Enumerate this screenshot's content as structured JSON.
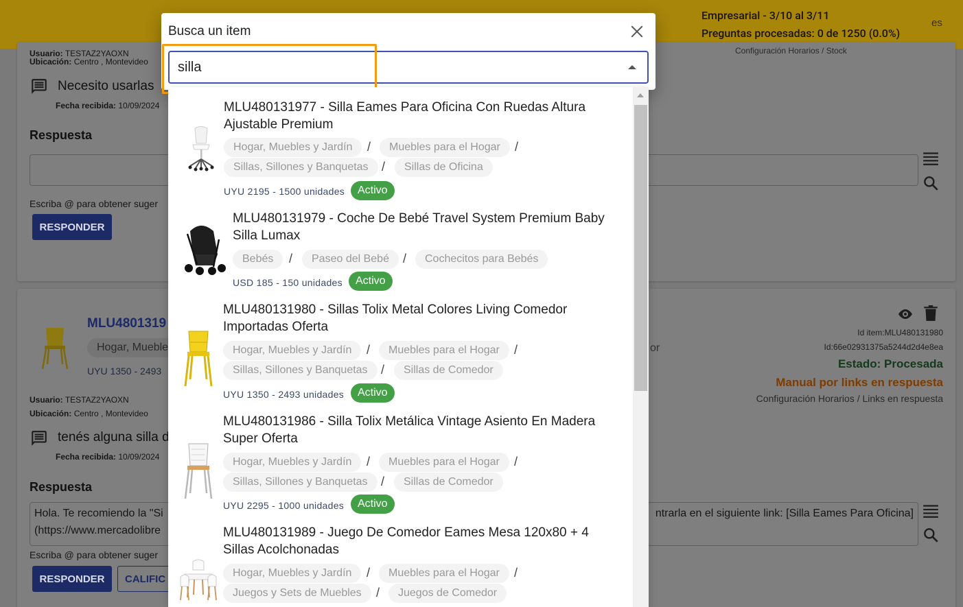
{
  "topbar": {
    "plan_line1": "Empresarial - 3/10 al 3/11",
    "plan_line2": "Preguntas procesadas: 0 de 1250 (0.0%)",
    "lang": "es"
  },
  "background": {
    "card1": {
      "user_label": "Usuario:",
      "user_value": "TESTAZ2YAOXN",
      "location_label": "Ubicación:",
      "location_value": "Centro , Montevideo",
      "question": "Necesito usarlas",
      "date_label": "Fecha recibida:",
      "date_value": "10/09/2024",
      "answer_label": "Respuesta",
      "hint": "Escriba @ para obtener suger",
      "respond_button": "RESPONDER",
      "top_right_text": "Configuración Horarios / Stock"
    },
    "card2": {
      "item_title": "MLU4801319",
      "category": "Hogar, Mueble",
      "price": "UYU 1350 - 2493",
      "category_tail": "or",
      "user_label": "Usuario:",
      "user_value": "TESTAZ2YAOXN",
      "location_label": "Ubicación:",
      "location_value": "Centro , Montevideo",
      "question": "tenés alguna silla d",
      "date_label": "Fecha recibida:",
      "date_value": "10/09/2024",
      "answer_label": "Respuesta",
      "answer_text_left_1": "Hola. Te recomiendo la \"Si",
      "answer_text_left_2": "(https://www.mercadolibre",
      "answer_text_right": "ntrarla en el siguiente link: [Silla Eames Para Oficina]",
      "hint": "Escriba @ para obtener suger",
      "respond_button": "RESPONDER",
      "qualify_button": "CALIFIC",
      "id_item": "Id item:MLU480131980",
      "id_hash": "Id:66e02931375a5244d2d4e8ea",
      "status": "Estado: Procesada",
      "mode": "Manual por links en respuesta",
      "config_links": "Configuración Horarios / Links en respuesta"
    }
  },
  "dialog": {
    "title": "Busca un item",
    "search_value": "silla"
  },
  "results": [
    {
      "title": "MLU480131977 - Silla Eames Para Oficina Con Ruedas Altura Ajustable Premium",
      "categories": [
        "Hogar, Muebles y Jardín",
        "Muebles para el Hogar",
        "Sillas, Sillones y Banquetas",
        "Sillas de Oficina"
      ],
      "price": "UYU 2195 - 1500 unidades",
      "status": "Activo",
      "image": "office-chair-icon"
    },
    {
      "title": "MLU480131979 - Coche De Bebé Travel System Premium Baby Silla Lumax",
      "categories": [
        "Bebés",
        "Paseo del Bebé",
        "Cochecitos para Bebés"
      ],
      "price": "USD 185 - 150 unidades",
      "status": "Activo",
      "image": "stroller-icon"
    },
    {
      "title": "MLU480131980 - Sillas Tolix Metal Colores Living Comedor Importadas Oferta",
      "categories": [
        "Hogar, Muebles y Jardín",
        "Muebles para el Hogar",
        "Sillas, Sillones y Banquetas",
        "Sillas de Comedor"
      ],
      "price": "UYU 1350 - 2493 unidades",
      "status": "Activo",
      "image": "yellow-chair-icon"
    },
    {
      "title": "MLU480131986 - Silla Tolix Metálica Vintage Asiento En Madera Super Oferta",
      "categories": [
        "Hogar, Muebles y Jardín",
        "Muebles para el Hogar",
        "Sillas, Sillones y Banquetas",
        "Sillas de Comedor"
      ],
      "price": "UYU 2295 - 1000 unidades",
      "status": "Activo",
      "image": "white-chair-icon"
    },
    {
      "title": "MLU480131989 - Juego De Comedor Eames Mesa 120x80 + 4 Sillas Acolchonadas",
      "categories": [
        "Hogar, Muebles y Jardín",
        "Muebles para el Hogar",
        "Juegos y Sets de Muebles",
        "Juegos de Comedor"
      ],
      "price": "",
      "status": "",
      "image": "dining-set-icon"
    }
  ],
  "colors": {
    "accent": "#3f51b5",
    "active_badge": "#43a047",
    "highlight": "#f39c12",
    "topbar": "#f2c01b"
  }
}
